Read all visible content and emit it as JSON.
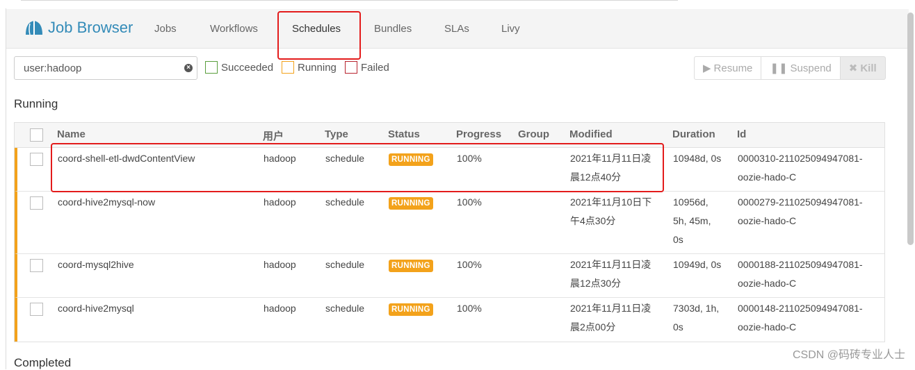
{
  "brand": {
    "title": "Job Browser",
    "color": "#338bb8",
    "icon": "hue-logo-icon"
  },
  "nav": {
    "items": [
      {
        "label": "Jobs"
      },
      {
        "label": "Workflows"
      },
      {
        "label": "Schedules",
        "active": true
      },
      {
        "label": "Bundles"
      },
      {
        "label": "SLAs"
      },
      {
        "label": "Livy"
      }
    ]
  },
  "search": {
    "value": "user:hadoop",
    "clear_icon": "clear-icon"
  },
  "filters": [
    {
      "label": "Succeeded",
      "color": "#5a9e3c"
    },
    {
      "label": "Running",
      "color": "#f3a21b"
    },
    {
      "label": "Failed",
      "color": "#b8232e"
    }
  ],
  "actions": {
    "resume": {
      "label": "Resume",
      "icon": "play-icon"
    },
    "suspend": {
      "label": "Suspend",
      "icon": "pause-icon"
    },
    "kill": {
      "label": "Kill",
      "icon": "close-icon"
    }
  },
  "sections": {
    "running": "Running",
    "completed": "Completed"
  },
  "table": {
    "headers": {
      "name": "Name",
      "user": "用户",
      "type": "Type",
      "status": "Status",
      "progress": "Progress",
      "group": "Group",
      "modified": "Modified",
      "duration": "Duration",
      "id": "Id"
    },
    "rows": [
      {
        "name": "coord-shell-etl-dwdContentView",
        "user": "hadoop",
        "type": "schedule",
        "status": "RUNNING",
        "progress": "100%",
        "group": "",
        "modified_1": "2021年11月11日凌",
        "modified_2": "晨12点40分",
        "duration_1": "10948d, 0s",
        "duration_2": "",
        "duration_3": "",
        "id_1": "0000310-211025094947081-",
        "id_2": "oozie-hado-C"
      },
      {
        "name": "coord-hive2mysql-now",
        "user": "hadoop",
        "type": "schedule",
        "status": "RUNNING",
        "progress": "100%",
        "group": "",
        "modified_1": "2021年11月10日下",
        "modified_2": "午4点30分",
        "duration_1": "10956d,",
        "duration_2": "5h, 45m,",
        "duration_3": "0s",
        "id_1": "0000279-211025094947081-",
        "id_2": "oozie-hado-C"
      },
      {
        "name": "coord-mysql2hive",
        "user": "hadoop",
        "type": "schedule",
        "status": "RUNNING",
        "progress": "100%",
        "group": "",
        "modified_1": "2021年11月11日凌",
        "modified_2": "晨12点30分",
        "duration_1": "10949d, 0s",
        "duration_2": "",
        "duration_3": "",
        "id_1": "0000188-211025094947081-",
        "id_2": "oozie-hado-C"
      },
      {
        "name": "coord-hive2mysql",
        "user": "hadoop",
        "type": "schedule",
        "status": "RUNNING",
        "progress": "100%",
        "group": "",
        "modified_1": "2021年11月11日凌",
        "modified_2": "晨2点00分",
        "duration_1": "7303d, 1h,",
        "duration_2": "0s",
        "duration_3": "",
        "id_1": "0000148-211025094947081-",
        "id_2": "oozie-hado-C"
      }
    ]
  },
  "colors": {
    "running_accent": "#f3a21b",
    "highlight_box": "#e31b1b"
  },
  "watermark": "CSDN @码砖专业人士"
}
